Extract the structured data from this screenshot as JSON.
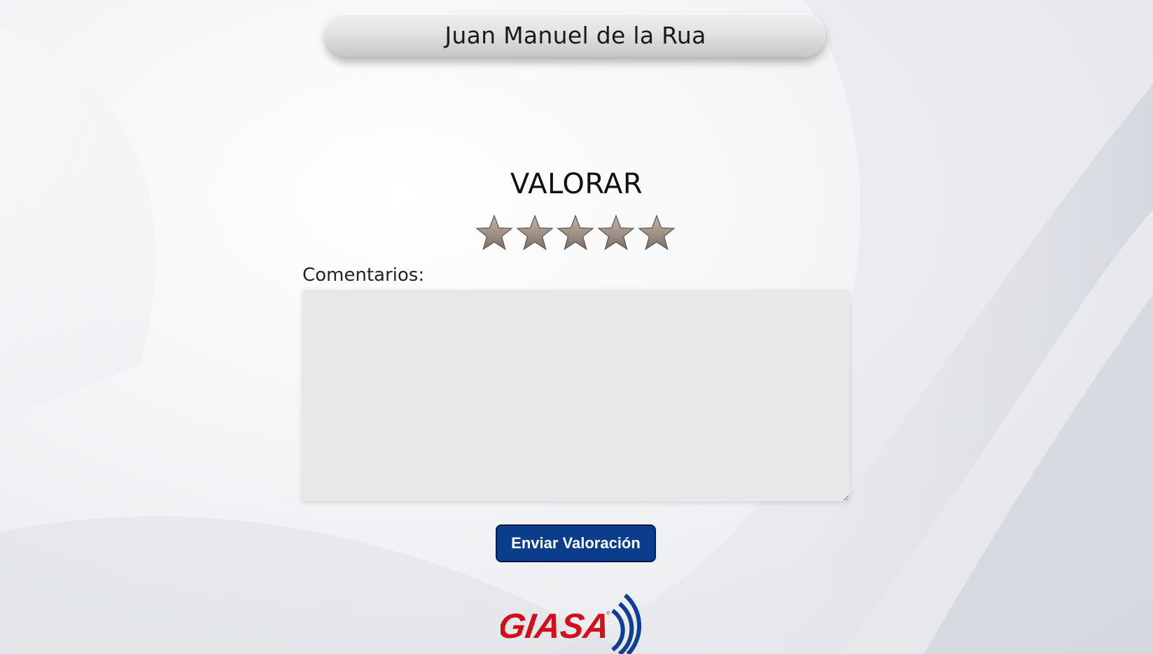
{
  "header": {
    "title": "Juan Manuel de la Rua"
  },
  "rating": {
    "heading": "VALORAR",
    "stars_total": 5,
    "stars_selected": 0,
    "star_icon": "star-icon",
    "star_color": "#9e9085"
  },
  "comments": {
    "label": "Comentarios:",
    "value": "",
    "placeholder": ""
  },
  "actions": {
    "submit_label": "Enviar Valoración",
    "submit_color": "#0c3c8c"
  },
  "footer": {
    "logo_text": "GIASA",
    "logo_red": "#d0101b",
    "logo_blue": "#0e3f94"
  }
}
